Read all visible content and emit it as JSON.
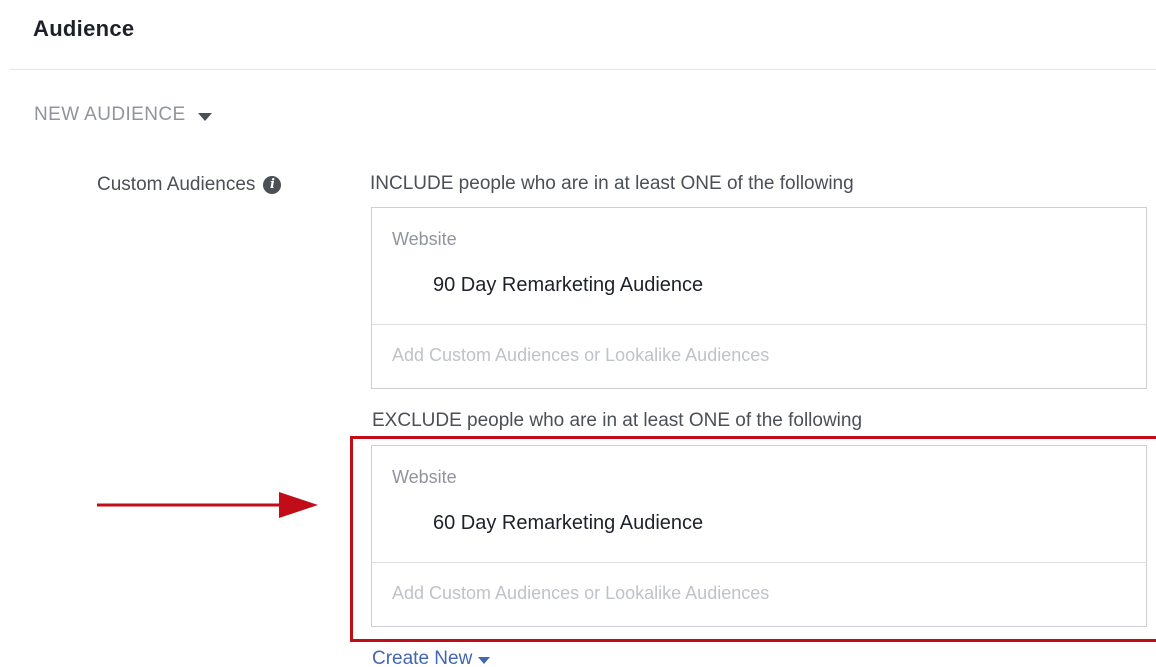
{
  "section": {
    "title": "Audience"
  },
  "new_audience": {
    "label": "NEW AUDIENCE",
    "dropdown_icon": "caret-down-icon"
  },
  "custom_audiences": {
    "label": "Custom Audiences",
    "info_icon": "info-icon",
    "include": {
      "rule": "INCLUDE people who are in at least ONE of the following",
      "category": "Website",
      "item": "90 Day Remarketing Audience",
      "placeholder": "Add Custom Audiences or Lookalike Audiences"
    },
    "exclude": {
      "rule": "EXCLUDE people who are in at least ONE of the following",
      "category": "Website",
      "item": "60 Day Remarketing Audience",
      "placeholder": "Add Custom Audiences or Lookalike Audiences"
    },
    "create_new_label": "Create New"
  },
  "annotation": {
    "highlight_color": "#c00d17",
    "pointer_icon": "arrow-right-icon"
  },
  "colors": {
    "link": "#4267b2",
    "muted_text": "#90949c",
    "placeholder_text": "#bec3c9",
    "border": "#ccd0d5"
  }
}
